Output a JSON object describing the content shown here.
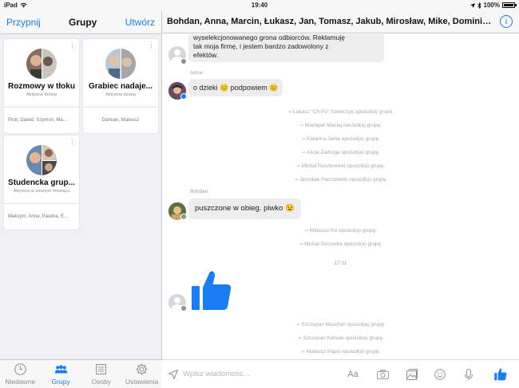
{
  "status": {
    "device": "iPad",
    "time": "19:40",
    "battery": "100%"
  },
  "left": {
    "back": "Przypnij",
    "title": "Grupy",
    "create": "Utwórz",
    "groups": [
      {
        "name": "Rozmowy w tłoku",
        "activity": "Aktywna dzisiaj",
        "members": "Piotr, Dawid, Szymon, Ma..."
      },
      {
        "name": "Grabiec nadaje...",
        "activity": "Aktywna dzisiaj",
        "members": "Damian, Mateusz"
      },
      {
        "name": "Studencka grup...",
        "activity": "Aktywna w zeszłym miesiącu",
        "members": "Maksym, Anna, Paulina, E..."
      }
    ]
  },
  "tabs": [
    {
      "label": "Niedawne",
      "icon": "clock-icon",
      "active": false
    },
    {
      "label": "Grupy",
      "icon": "people-icon",
      "active": true
    },
    {
      "label": "Osoby",
      "icon": "list-icon",
      "active": false
    },
    {
      "label": "Ustawienia",
      "icon": "gear-icon",
      "active": false
    }
  ],
  "chat": {
    "title": "Bohdan, Anna, Marcin, Łukasz, Jan, Tomasz, Jakub, Mirosław, Mike, Dominika,...",
    "first_msg_lines": [
      "wyselekcjonowanego grona odbiorców. Reklamuję",
      "tak  moja firmę, i jestem bardzo zadowolony z",
      "efektów."
    ],
    "anna_label": "Anna",
    "anna_msg": "o dzieki 😊 podpowiem 😊",
    "left_msgs_1": [
      "Łukasz \"Ch-Fu\" Szewczyk opuścił(a) grupę.",
      "Maciejak Maciej opuścił(a) grupę.",
      "Katarina Janta opuścił(a) grupę.",
      "Alicja Zadroga opuścił(a) grupę.",
      "Michał Ruszkowski opuścił(a) grupę.",
      "Jarosław Parczewski opuścił(a) grupę."
    ],
    "bohdan_label": "Bohdan",
    "bohdan_msg": "puszczone w obieg. piwko 😉",
    "left_msgs_2": [
      "Mateusz Ka opuścił(a) grupę.",
      "Michał Szczerba opuścił(a) grupę."
    ],
    "time_sep": "17:11",
    "left_msgs_3": [
      "Szczepan Muscher opuścił(a) grupę.",
      "Szczepan Kalsiak opuścił(a) grupę.",
      "Mateusz Papis opuścił(a) grupę."
    ],
    "composer_placeholder": "Wpisz wiadomość...",
    "aa_label": "Aa"
  },
  "colors": {
    "accent": "#1a7cf5",
    "messenger_badge": "#1a7cf5",
    "facebook_badge": "#8f8f8f"
  }
}
